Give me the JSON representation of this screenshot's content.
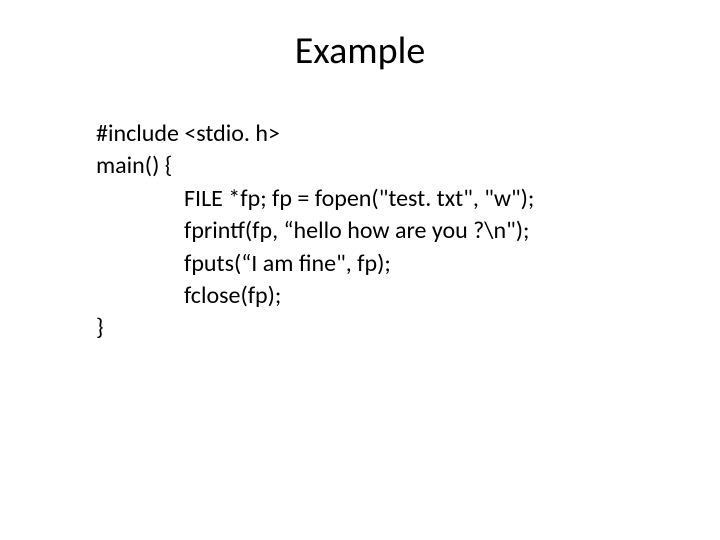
{
  "title": "Example",
  "code": {
    "line1": "#include <stdio. h>",
    "line2": "main() {",
    "line3": "FILE *fp; fp = fopen(\"test. txt\", \"w\");",
    "line4": "fprintf(fp, “hello how are you ?\\n\");",
    "line5": "fputs(“I am fine\", fp);",
    "line6": "fclose(fp);",
    "line7": "}"
  }
}
